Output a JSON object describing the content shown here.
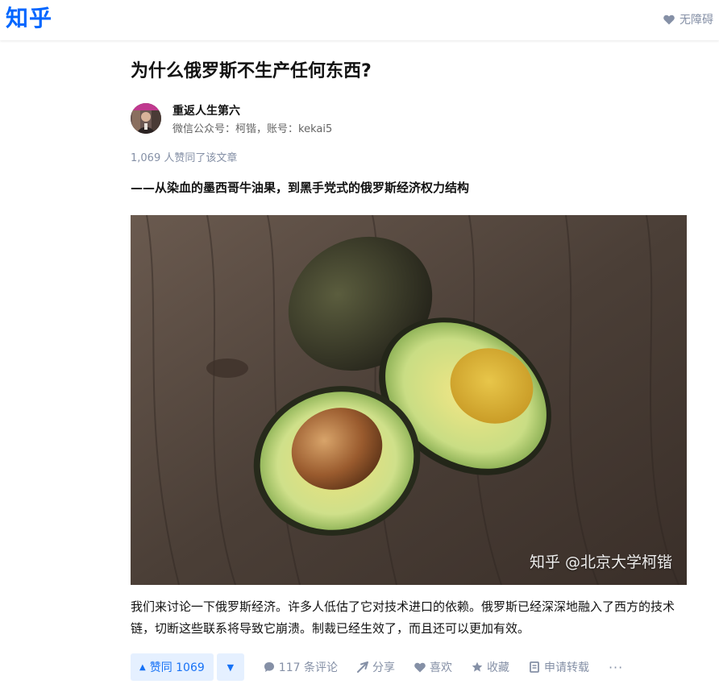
{
  "header": {
    "logo": "知乎",
    "accessibility_label": "无障碍"
  },
  "article": {
    "title": "为什么俄罗斯不生产任何东西?",
    "author": {
      "name": "重返人生第六",
      "bio": "微信公众号：柯锴，账号：kekai5"
    },
    "vote_meta": "1,069 人赞同了该文章",
    "subtitle": "——从染血的墨西哥牛油果，到黑手党式的俄罗斯经济权力结构",
    "image_watermark": "知乎 @北京大学柯锴",
    "body": "我们来讨论一下俄罗斯经济。许多人低估了它对技术进口的依赖。俄罗斯已经深深地融入了西方的技术链，切断这些联系将导致它崩溃。制裁已经生效了，而且还可以更加有效。"
  },
  "actions": {
    "vote_up_label": "赞同 1069",
    "comments_label": "117 条评论",
    "share_label": "分享",
    "like_label": "喜欢",
    "favorite_label": "收藏",
    "repost_label": "申请转载",
    "more_label": "···"
  },
  "colors": {
    "brand": "#0066ff",
    "vote_bg": "#e5f0ff",
    "vote_text": "#1772f6",
    "muted": "#8590a6"
  }
}
